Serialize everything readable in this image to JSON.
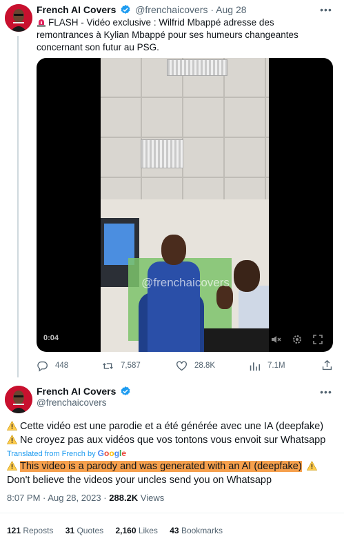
{
  "tweet1": {
    "author_name": "French AI Covers",
    "handle": "@frenchaicovers",
    "separator": "·",
    "date": "Aug 28",
    "text": "FLASH - Vidéo exclusive : Wilfrid Mbappé adresse des remontrances à Kylian Mbappé pour ses humeurs changeantes concernant son futur au PSG.",
    "video": {
      "watermark": "@frenchaicovers",
      "time": "0:04"
    },
    "actions": {
      "replies": "448",
      "reposts": "7,587",
      "likes": "28.8K",
      "views": "7.1M"
    }
  },
  "tweet2": {
    "author_name": "French AI Covers",
    "handle": "@frenchaicovers",
    "lines": [
      "Cette vidéo est une parodie et a été générée avec une IA (deepfake)",
      "Ne croyez pas aux vidéos que vos tontons vous envoit sur Whatsapp"
    ],
    "translated_label": "Translated from French by",
    "translator": "Google",
    "translation": {
      "line1": "This video is a parody and was generated with an AI (deepfake)",
      "line2": "Don't believe the videos your uncles send you on Whatsapp"
    },
    "meta": {
      "time": "8:07 PM",
      "sep": "·",
      "date": "Aug 28, 2023",
      "sep2": "·",
      "views_count": "288.2K",
      "views_label": "Views"
    },
    "stats": {
      "reposts_count": "121",
      "reposts_label": "Reposts",
      "quotes_count": "31",
      "quotes_label": "Quotes",
      "likes_count": "2,160",
      "likes_label": "Likes",
      "bookmarks_count": "43",
      "bookmarks_label": "Bookmarks"
    }
  },
  "colors": {
    "accent": "#1d9bf0",
    "highlight": "#f6a04d",
    "muted": "#536471",
    "avatar_red": "#c8102e"
  }
}
